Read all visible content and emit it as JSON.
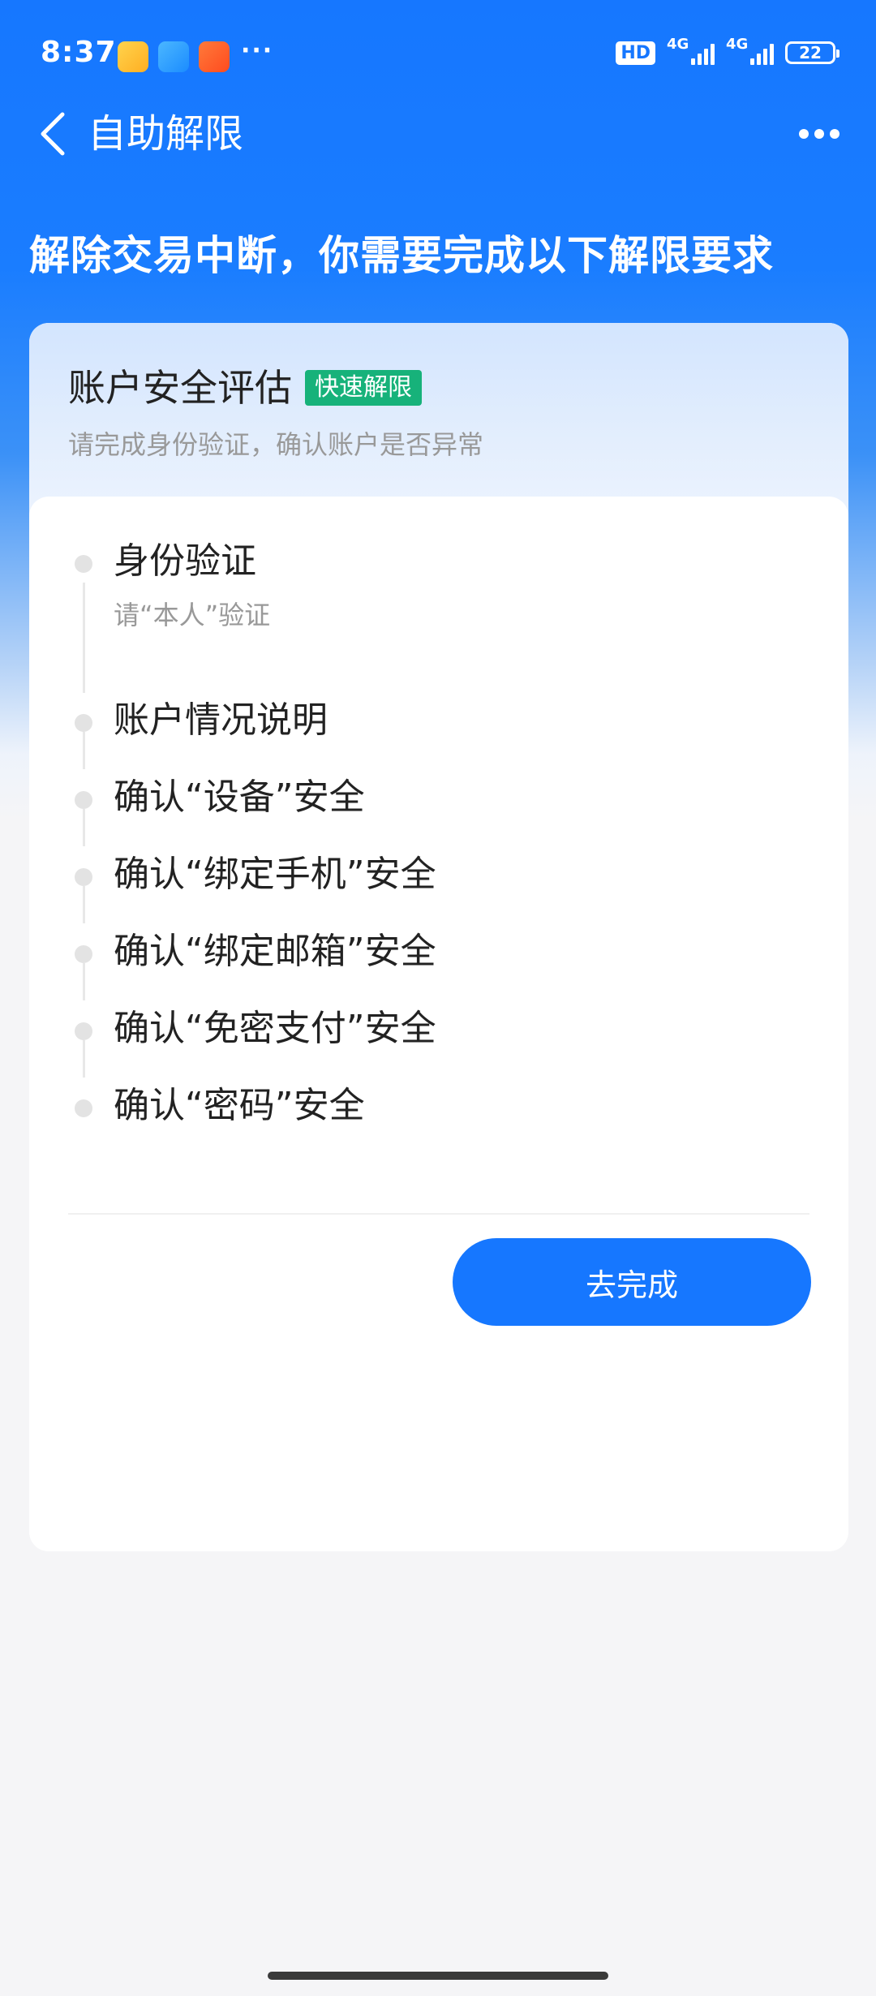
{
  "status_bar": {
    "time": "8:37",
    "more": "···",
    "hd": "HD",
    "network_1": "4G",
    "network_2": "4G",
    "battery": "22"
  },
  "nav": {
    "title": "自助解限",
    "back_icon": "chevron-left-icon",
    "more_icon": "more-dots-icon"
  },
  "headline": "解除交易中断，你需要完成以下解限要求",
  "card": {
    "title": "账户安全评估",
    "badge": "快速解限",
    "subtitle": "请完成身份验证，确认账户是否异常",
    "steps": [
      {
        "label": "身份验证",
        "sub": "请“本人”验证"
      },
      {
        "label": "账户情况说明"
      },
      {
        "label": "确认“设备”安全"
      },
      {
        "label": "确认“绑定手机”安全"
      },
      {
        "label": "确认“绑定邮箱”安全"
      },
      {
        "label": "确认“免密支付”安全"
      },
      {
        "label": "确认“密码”安全"
      }
    ],
    "button_label": "去完成"
  },
  "colors": {
    "brand_blue": "#1677ff",
    "badge_green": "#17b27a"
  }
}
